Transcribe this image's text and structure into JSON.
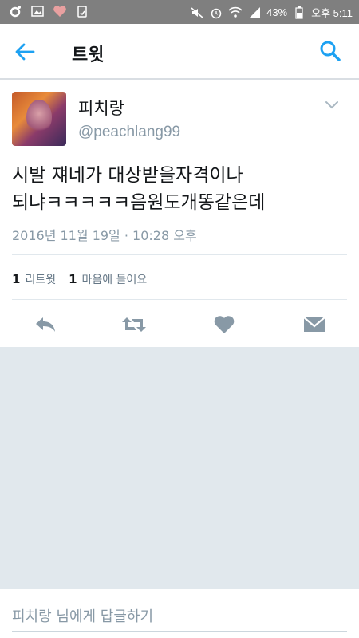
{
  "statusbar": {
    "battery_percent": "43%",
    "time": "오후 5:11",
    "icons": [
      "ring-icon",
      "gallery-icon",
      "heart-app-icon",
      "clipboard-icon",
      "mute-icon",
      "alarm-icon",
      "wifi-icon",
      "signal-icon",
      "battery-icon"
    ]
  },
  "appbar": {
    "title": "트윗"
  },
  "tweet": {
    "display_name": "피치랑",
    "handle": "@peachlang99",
    "text_line1": "시발 쟤네가 대상받을자격이나",
    "text_line2": "되냐ㅋㅋㅋㅋㅋ음원도개똥같은데",
    "timestamp": "2016년 11월 19일 · 10:28 오후",
    "retweets_count": "1",
    "retweets_label": "리트윗",
    "likes_count": "1",
    "likes_label": "마음에 들어요"
  },
  "reply": {
    "placeholder": "피치랑 님에게 답글하기"
  },
  "colors": {
    "accent": "#1da1f2",
    "action_icon": "#8899a6",
    "text_primary": "#14171a",
    "text_secondary": "#8899a6",
    "statusbar_bg": "#7f7f7f",
    "page_bg": "#e1e8ed"
  }
}
